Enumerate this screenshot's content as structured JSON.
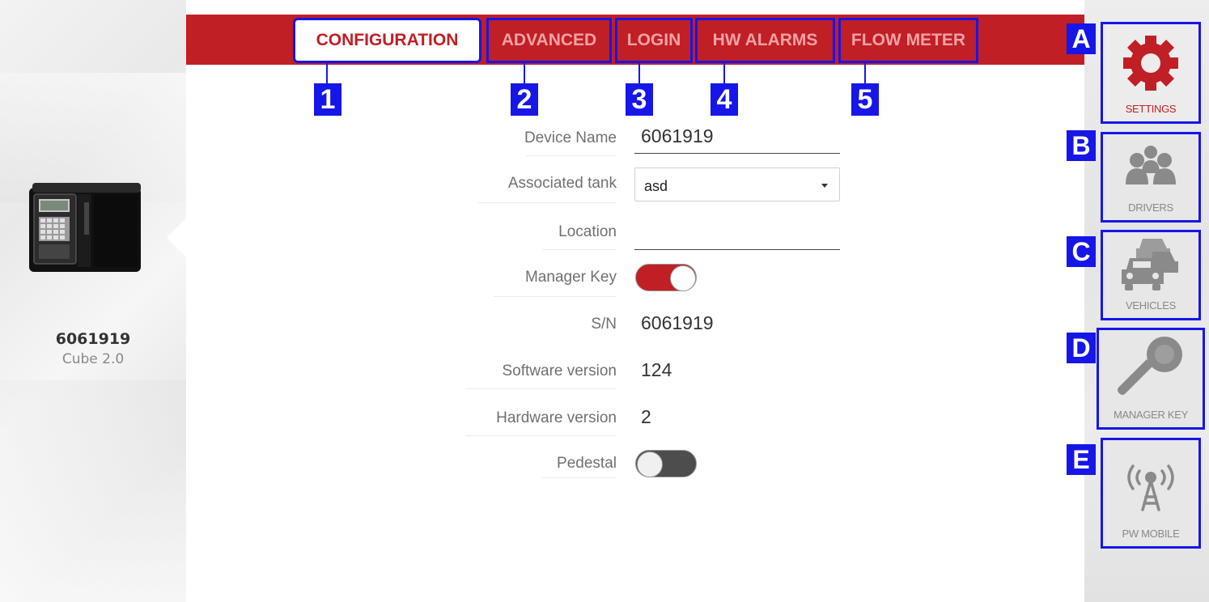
{
  "device": {
    "name": "6061919",
    "model": "Cube 2.0"
  },
  "tabs": [
    {
      "label": "CONFIGURATION",
      "number": "1",
      "active": true
    },
    {
      "label": "ADVANCED",
      "number": "2",
      "active": false
    },
    {
      "label": "LOGIN",
      "number": "3",
      "active": false
    },
    {
      "label": "HW ALARMS",
      "number": "4",
      "active": false
    },
    {
      "label": "FLOW METER",
      "number": "5",
      "active": false
    }
  ],
  "sidebar": [
    {
      "letter": "A",
      "label": "SETTINGS",
      "icon": "gear-icon",
      "active": true
    },
    {
      "letter": "B",
      "label": "DRIVERS",
      "icon": "people-icon",
      "active": false
    },
    {
      "letter": "C",
      "label": "VEHICLES",
      "icon": "cars-icon",
      "active": false
    },
    {
      "letter": "D",
      "label": "MANAGER KEY",
      "icon": "key-icon",
      "active": false
    },
    {
      "letter": "E",
      "label": "PW MOBILE",
      "icon": "antenna-icon",
      "active": false
    }
  ],
  "form": {
    "device_name_label": "Device Name",
    "device_name_value": "6061919",
    "associated_tank_label": "Associated tank",
    "associated_tank_value": "asd",
    "location_label": "Location",
    "location_value": "",
    "manager_key_label": "Manager Key",
    "manager_key_on": true,
    "sn_label": "S/N",
    "sn_value": "6061919",
    "software_version_label": "Software version",
    "software_version_value": "124",
    "hardware_version_label": "Hardware version",
    "hardware_version_value": "2",
    "pedestal_label": "Pedestal",
    "pedestal_on": false
  },
  "colors": {
    "accent": "#c01f25",
    "annotation": "#1616e8",
    "inactive_tab_text": "#f2a1a4"
  }
}
